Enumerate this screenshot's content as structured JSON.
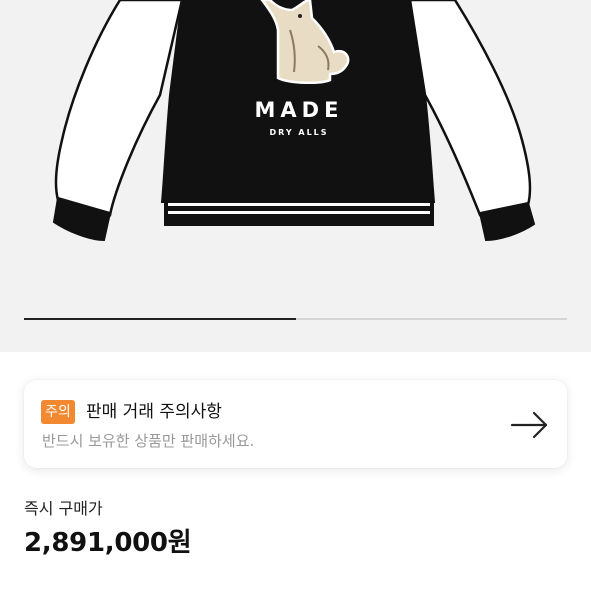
{
  "product": {
    "image_text": {
      "brand": "MADE",
      "sub": "DRY ALLS"
    },
    "carousel_progress": 0.5
  },
  "notice": {
    "badge": "주의",
    "title": "판매 거래 주의사항",
    "description": "반드시 보유한 상품만 판매하세요.",
    "arrow_icon": "arrow-right-icon"
  },
  "price": {
    "label": "즉시 구매가",
    "value": "2,891,000원"
  },
  "colors": {
    "badge": "#f2882f",
    "jacket_body": "#111111",
    "image_background": "#f2f2f2"
  }
}
